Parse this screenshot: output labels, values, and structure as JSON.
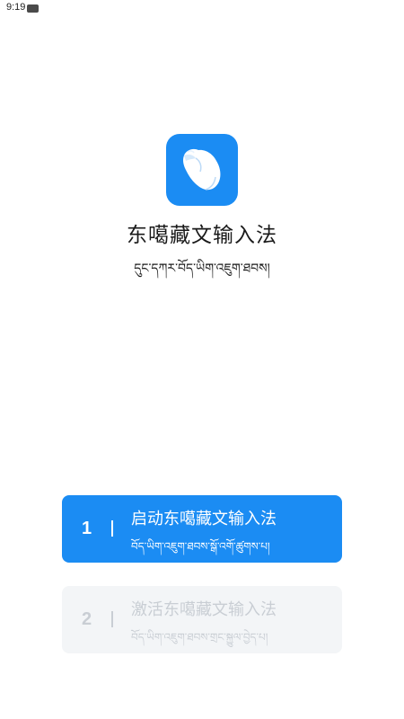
{
  "status_bar": {
    "time": "9:19"
  },
  "app": {
    "icon": "conch-shell-icon",
    "title": "东噶藏文输入法",
    "subtitle": "དུང་དཀར་བོད་ཡིག་འཇུག་ཐབས།"
  },
  "steps": [
    {
      "number": "1",
      "title": "启动东噶藏文输入法",
      "subtitle": "བོད་ཡིག་འཇུག་ཐབས་སྒོ་འགོ་ཚུགས་པ།",
      "enabled": true
    },
    {
      "number": "2",
      "title": "激活东噶藏文输入法",
      "subtitle": "བོད་ཡིག་འཇུག་ཐབས་གྲང་སྐྱུལ་བྱེད་པ།",
      "enabled": false
    }
  ],
  "colors": {
    "accent": "#1b8cf3",
    "disabled_bg": "#f3f5f7",
    "disabled_text": "#c9ced4"
  }
}
